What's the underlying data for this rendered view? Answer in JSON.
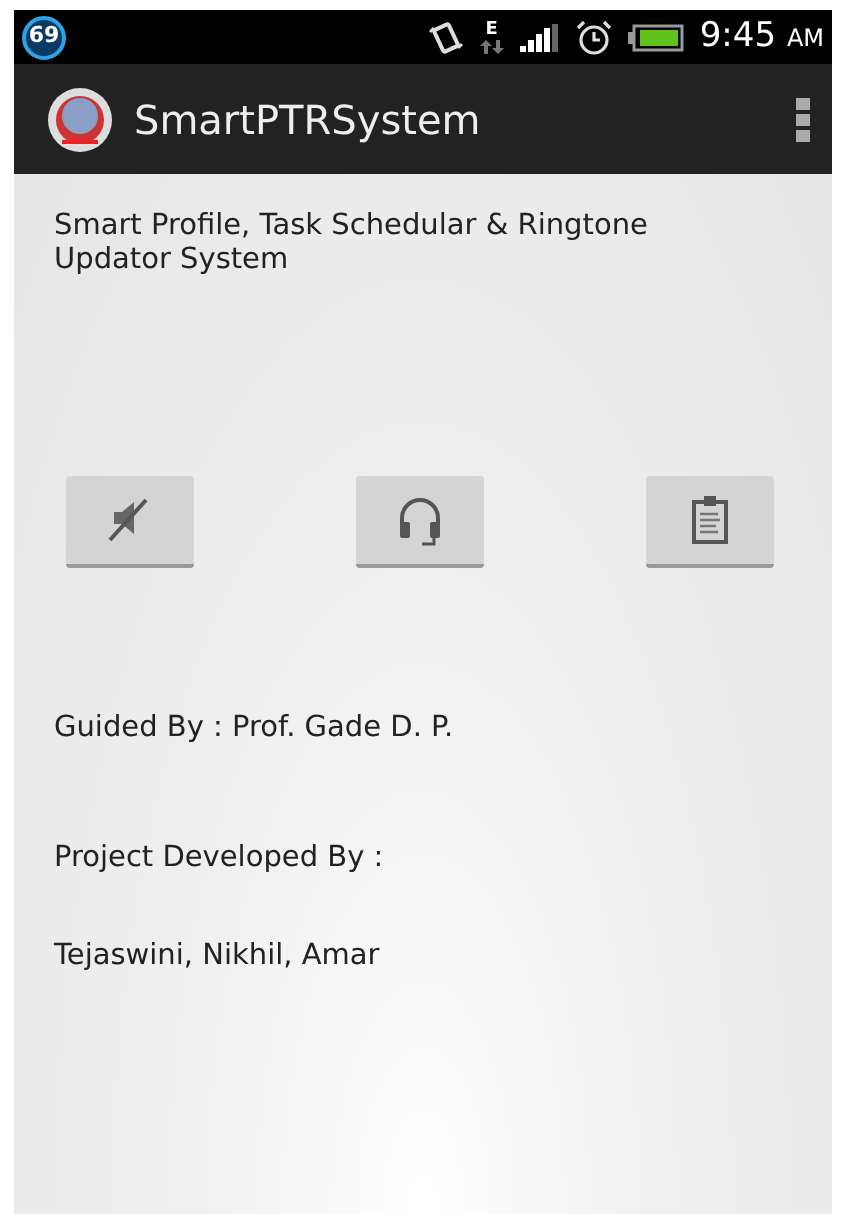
{
  "status_bar": {
    "notification_count": "69",
    "network": "E",
    "time": "9:45",
    "time_suffix": "AM"
  },
  "action_bar": {
    "title": "SmartPTRSystem"
  },
  "description": "Smart Profile, Task Schedular & Ringtone Updator System",
  "buttons": [
    {
      "kind": "mute"
    },
    {
      "kind": "headset"
    },
    {
      "kind": "clipboard"
    }
  ],
  "guided_by": "Guided By : Prof. Gade D. P.",
  "developed_by_label": "Project Developed By :",
  "developers": "Tejaswini, Nikhil, Amar"
}
